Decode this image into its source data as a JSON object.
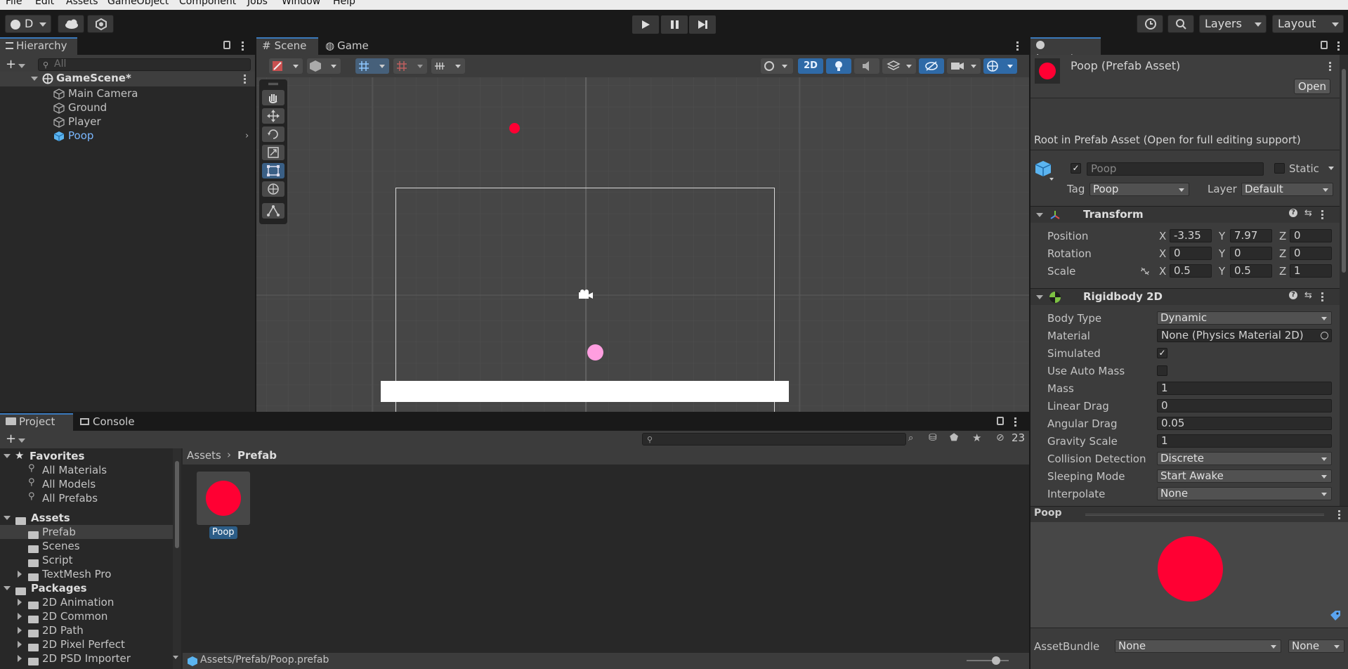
{
  "menu": [
    "File",
    "Edit",
    "Assets",
    "GameObject",
    "Component",
    "Jobs",
    "Window",
    "Help"
  ],
  "toolbar": {
    "account": "D",
    "layers": "Layers",
    "layout": "Layout"
  },
  "hierarchy": {
    "tab": "Hierarchy",
    "search_placeholder": "All",
    "scene": "GameScene*",
    "items": [
      "Main Camera",
      "Ground",
      "Player",
      "Poop"
    ]
  },
  "scene_view": {
    "tabs": [
      "Scene",
      "Game"
    ],
    "mode_2d": "2D"
  },
  "inspector": {
    "tab": "Inspector",
    "asset_title": "Poop (Prefab Asset)",
    "open_label": "Open",
    "root_note": "Root in Prefab Asset (Open for full editing support)",
    "name": "Poop",
    "static_label": "Static",
    "tag_label": "Tag",
    "tag_value": "Poop",
    "layer_label": "Layer",
    "layer_value": "Default",
    "transform": {
      "title": "Transform",
      "position_label": "Position",
      "position": {
        "x": "-3.35",
        "y": "7.97",
        "z": "0"
      },
      "rotation_label": "Rotation",
      "rotation": {
        "x": "0",
        "y": "0",
        "z": "0"
      },
      "scale_label": "Scale",
      "scale": {
        "x": "0.5",
        "y": "0.5",
        "z": "1"
      }
    },
    "rigidbody": {
      "title": "Rigidbody 2D",
      "body_type_label": "Body Type",
      "body_type": "Dynamic",
      "material_label": "Material",
      "material": "None (Physics Material 2D)",
      "simulated_label": "Simulated",
      "simulated": true,
      "auto_mass_label": "Use Auto Mass",
      "auto_mass": false,
      "mass_label": "Mass",
      "mass": "1",
      "linear_drag_label": "Linear Drag",
      "linear_drag": "0",
      "angular_drag_label": "Angular Drag",
      "angular_drag": "0.05",
      "gravity_label": "Gravity Scale",
      "gravity": "1",
      "collision_label": "Collision Detection",
      "collision": "Discrete",
      "sleeping_label": "Sleeping Mode",
      "sleeping": "Start Awake",
      "interpolate_label": "Interpolate",
      "interpolate": "None"
    },
    "preview_title": "Poop",
    "assetbundle_label": "AssetBundle",
    "assetbundle_value": "None",
    "assetbundle_variant": "None"
  },
  "project": {
    "tabs": [
      "Project",
      "Console"
    ],
    "hidden_count": "23",
    "favorites_label": "Favorites",
    "favorites": [
      "All Materials",
      "All Models",
      "All Prefabs"
    ],
    "assets_label": "Assets",
    "assets": [
      "Prefab",
      "Scenes",
      "Script",
      "TextMesh Pro"
    ],
    "packages_label": "Packages",
    "packages": [
      "2D Animation",
      "2D Common",
      "2D Path",
      "2D Pixel Perfect",
      "2D PSD Importer"
    ],
    "breadcrumb": [
      "Assets",
      "Prefab"
    ],
    "asset_name": "Poop",
    "status_path": "Assets/Prefab/Poop.prefab"
  },
  "colors": {
    "accent": "#3a79bb",
    "poop": "#ff0033",
    "player": "#ff9ee0",
    "selection": "#2c5d87"
  }
}
